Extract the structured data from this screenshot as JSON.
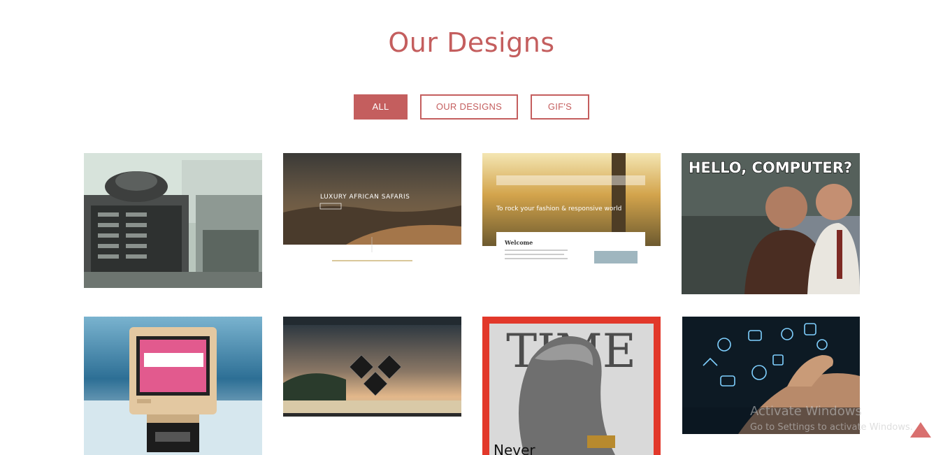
{
  "section": {
    "title": "Our Designs"
  },
  "filters": [
    {
      "label": "ALL",
      "active": true
    },
    {
      "label": "OUR DESIGNS",
      "active": false
    },
    {
      "label": "GIF'S",
      "active": false
    }
  ],
  "gallery": {
    "tiles": [
      {
        "name": "vintage-computer-lab-gif"
      },
      {
        "name": "luxury-safari-website-design",
        "heading": "LUXURY AFRICAN SAFARIS"
      },
      {
        "name": "responsive-website-design",
        "tagline": "To rock your fashion & responsive world",
        "heading": "Welcome"
      },
      {
        "name": "hello-computer-gif",
        "caption": "HELLO, COMPUTER?"
      },
      {
        "name": "retro-crt-vhs-art"
      },
      {
        "name": "resort-website-design"
      },
      {
        "name": "time-magazine-fist-cover",
        "masthead": "TIME",
        "caption": "Never"
      },
      {
        "name": "digital-hand-icons"
      }
    ]
  },
  "watermark": {
    "title": "Activate Windows",
    "subtitle": "Go to Settings to activate Windows."
  },
  "colors": {
    "accent": "#c45e5e",
    "accent_light": "#d9706f"
  }
}
